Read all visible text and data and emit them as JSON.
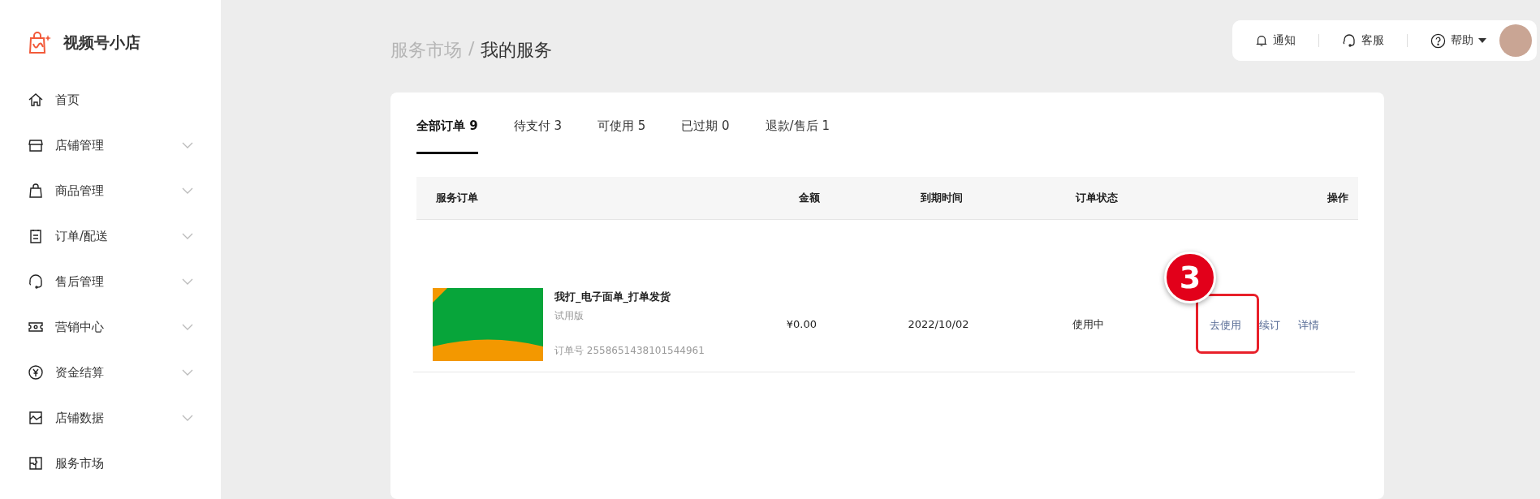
{
  "brand": {
    "name": "视频号小店"
  },
  "sidebar": {
    "items": [
      {
        "label": "首页",
        "collapsible": false
      },
      {
        "label": "店铺管理",
        "collapsible": true
      },
      {
        "label": "商品管理",
        "collapsible": true
      },
      {
        "label": "订单/配送",
        "collapsible": true
      },
      {
        "label": "售后管理",
        "collapsible": true
      },
      {
        "label": "营销中心",
        "collapsible": true
      },
      {
        "label": "资金结算",
        "collapsible": true
      },
      {
        "label": "店铺数据",
        "collapsible": true
      },
      {
        "label": "服务市场",
        "collapsible": false
      }
    ]
  },
  "breadcrumb": [
    "服务市场",
    "/",
    "我的服务"
  ],
  "header": {
    "items": [
      {
        "label": "通知",
        "kind": "notice"
      },
      {
        "label": "客服",
        "kind": "service"
      },
      {
        "label": "帮助",
        "kind": "help"
      }
    ]
  },
  "tabs": [
    {
      "label": "全部订单 9",
      "selected": true
    },
    {
      "label": "待支付 3",
      "selected": false
    },
    {
      "label": "可使用 5",
      "selected": false
    },
    {
      "label": "已过期 0",
      "selected": false
    },
    {
      "label": "退款/售后 1",
      "selected": false
    }
  ],
  "table": {
    "columns": [
      "服务订单",
      "金额",
      "到期时间",
      "订单状态",
      "操作"
    ],
    "rows": [
      {
        "name": "我打_电子面单_打单发货",
        "edition": "试用版",
        "order_no": "订单号 2558651438101544961",
        "amount": "¥0.00",
        "expires": "2022/10/02",
        "status": "使用中",
        "actions": [
          {
            "label": "去使用",
            "highlighted": true
          },
          {
            "label": "续订",
            "highlighted": false
          },
          {
            "label": "详情",
            "highlighted": false
          }
        ]
      }
    ]
  },
  "callout": {
    "label": "3"
  }
}
